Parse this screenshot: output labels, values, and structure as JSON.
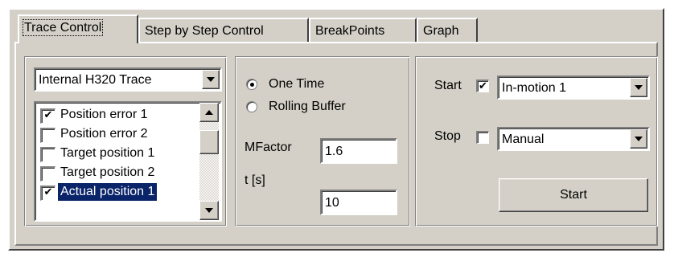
{
  "tabs": [
    {
      "label": "Trace Control",
      "active": true
    },
    {
      "label": "Step by Step Control",
      "active": false
    },
    {
      "label": "BreakPoints",
      "active": false
    },
    {
      "label": "Graph",
      "active": false
    }
  ],
  "trace_source": {
    "selected": "Internal H320 Trace"
  },
  "signals": [
    {
      "label": "Position error 1",
      "checked": true,
      "selected": false
    },
    {
      "label": "Position error 2",
      "checked": false,
      "selected": false
    },
    {
      "label": "Target position 1",
      "checked": false,
      "selected": false
    },
    {
      "label": "Target position 2",
      "checked": false,
      "selected": false
    },
    {
      "label": "Actual position 1",
      "checked": true,
      "selected": true
    }
  ],
  "mode": {
    "options": [
      {
        "label": "One Time",
        "selected": true
      },
      {
        "label": "Rolling Buffer",
        "selected": false
      }
    ]
  },
  "mfactor": {
    "label": "MFactor",
    "value": "1.6"
  },
  "t": {
    "label": "t [s]",
    "value": "10"
  },
  "start": {
    "label": "Start",
    "checked": true,
    "trigger": "In-motion 1"
  },
  "stop": {
    "label": "Stop",
    "checked": false,
    "trigger": "Manual"
  },
  "start_button": {
    "label": "Start"
  },
  "check_glyph": "✔"
}
